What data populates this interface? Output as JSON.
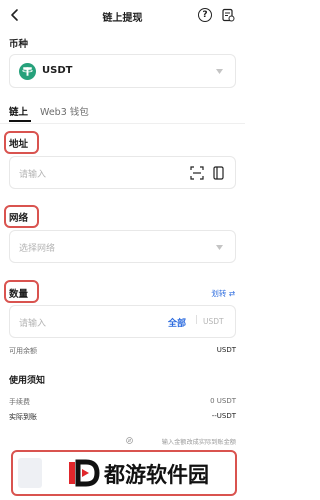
{
  "header": {
    "title": "链上提现",
    "help_glyph": "?",
    "back_icon": "chevron-left-icon",
    "records_icon": "records-icon"
  },
  "currency": {
    "section_label": "币种",
    "selected": "USDT",
    "token_color": "#26a17b"
  },
  "tabs": {
    "items": [
      "链上",
      "Web3 钱包"
    ],
    "active": 0
  },
  "address": {
    "label": "地址",
    "placeholder": "请输入"
  },
  "network": {
    "label": "网络",
    "placeholder": "选择网络"
  },
  "amount": {
    "label": "数量",
    "transfer_link": "划转 ⇄",
    "placeholder": "请输入",
    "all_button": "全部",
    "unit": "USDT"
  },
  "balance": {
    "label": "可用余额",
    "value": "USDT"
  },
  "notes": {
    "title": "使用须知"
  },
  "fees": {
    "fee_label": "手续费",
    "fee_value": "0 USDT",
    "received_label": "实际到账",
    "received_value": "--USDT"
  },
  "hint": "输入金额改成实际到账金额",
  "watermark": {
    "text": "都游软件园"
  },
  "colors": {
    "link": "#2d6cdf",
    "accent_red": "#d9534f",
    "placeholder": "#b4b4b4"
  }
}
